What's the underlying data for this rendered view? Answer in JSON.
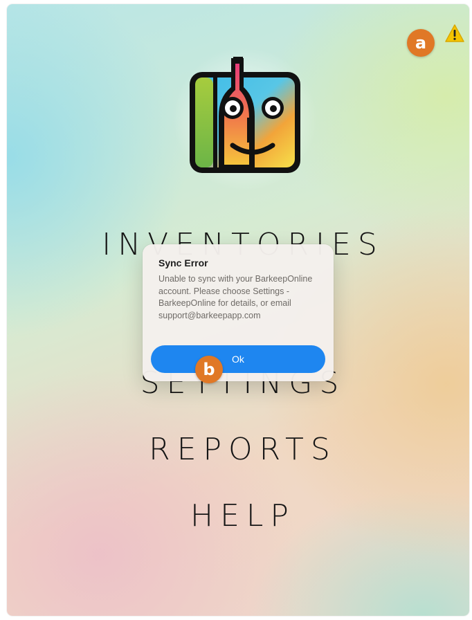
{
  "annotations": {
    "a": "a",
    "b": "b"
  },
  "menu": {
    "items": [
      {
        "label": "INVENTORIES"
      },
      {
        "label": "SETTINGS"
      },
      {
        "label": "REPORTS"
      },
      {
        "label": "HELP"
      }
    ]
  },
  "dialog": {
    "title": "Sync Error",
    "message": "Unable to sync with your BarkeepOnline account.  Please choose Settings - BarkeepOnline for details, or email support@barkeepapp.com",
    "ok_label": "Ok"
  },
  "icons": {
    "warning": "warning-triangle-icon",
    "logo": "barkeep-app-logo"
  },
  "colors": {
    "accent": "#1e86f0",
    "callout": "#e07826",
    "warning": "#f5c400"
  }
}
